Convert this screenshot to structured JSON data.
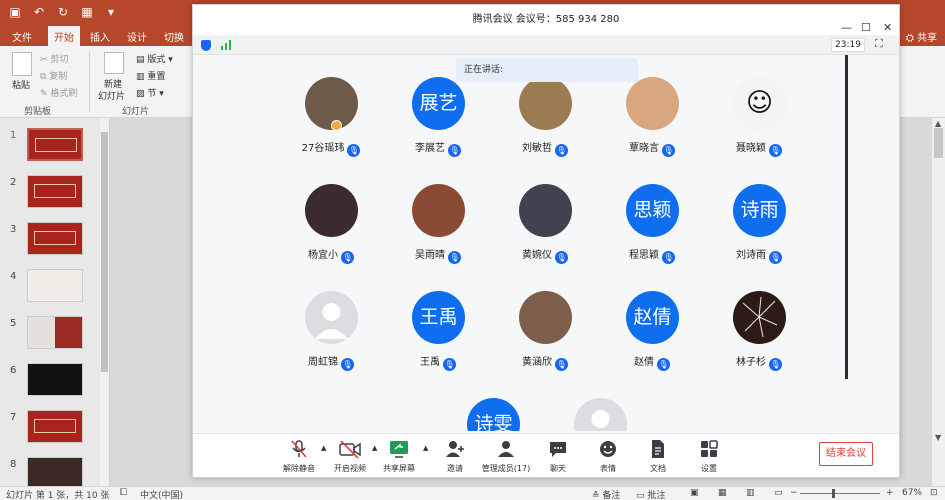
{
  "powerpoint": {
    "tabs": [
      "文件",
      "开始",
      "插入",
      "设计",
      "切换"
    ],
    "share": "共享",
    "ribbon": {
      "paste": "粘贴",
      "cut": "剪切",
      "copy": "复制",
      "format_painter": "格式刷",
      "clipboard": "剪贴板",
      "new_slide_1": "新建",
      "new_slide_2": "幻灯片",
      "layout": "版式",
      "reset": "重置",
      "section": "节",
      "slides_group": "幻灯片"
    },
    "slide_numbers": [
      "1",
      "2",
      "3",
      "4",
      "5",
      "6",
      "7",
      "8"
    ],
    "status": {
      "slide_info": "幻灯片 第 1 张，共 10 张",
      "language": "中文(中国)",
      "notes": "备注",
      "comments": "批注",
      "zoom": "67%"
    }
  },
  "meeting": {
    "title": "腾讯会议 会议号：585 934 280",
    "timer": "23:19",
    "speaking_label": "正在讲话:",
    "participants": [
      {
        "name": "27谷瑶玮",
        "avatar_type": "photo",
        "avatar_color": "#6e5a48",
        "host": true
      },
      {
        "name": "李展艺",
        "avatar_type": "text",
        "avatar_text": "展艺"
      },
      {
        "name": "刘敏哲",
        "avatar_type": "photo",
        "avatar_color": "#9a7b52"
      },
      {
        "name": "覃晓言",
        "avatar_type": "photo",
        "avatar_color": "#d8a77f"
      },
      {
        "name": "聂晓颖",
        "avatar_type": "photo",
        "avatar_color": "#f4f4f4"
      },
      {
        "name": "杨宜小",
        "avatar_type": "photo",
        "avatar_color": "#3b2a2f"
      },
      {
        "name": "吴雨晴",
        "avatar_type": "photo",
        "avatar_color": "#8a4b35"
      },
      {
        "name": "黄婉仪",
        "avatar_type": "photo",
        "avatar_color": "#40434f"
      },
      {
        "name": "程思颖",
        "avatar_type": "text",
        "avatar_text": "思颖"
      },
      {
        "name": "刘诗雨",
        "avatar_type": "text",
        "avatar_text": "诗雨"
      },
      {
        "name": "周虹锦",
        "avatar_type": "grey"
      },
      {
        "name": "王禹",
        "avatar_type": "text",
        "avatar_text": "王禹"
      },
      {
        "name": "黄涵欣",
        "avatar_type": "photo",
        "avatar_color": "#7d5e4a"
      },
      {
        "name": "赵倩",
        "avatar_type": "text",
        "avatar_text": "赵倩"
      },
      {
        "name": "林子杉",
        "avatar_type": "photo",
        "avatar_color": "#2b1a16"
      },
      {
        "name": "",
        "avatar_type": "text",
        "avatar_text": "诗雯"
      },
      {
        "name": "",
        "avatar_type": "grey"
      }
    ],
    "toolbar": {
      "mute": "解除静音",
      "video": "开启视频",
      "share": "共享屏幕",
      "invite": "邀请",
      "members": "管理成员(17)",
      "chat": "聊天",
      "reactions": "表情",
      "docs": "文档",
      "settings": "设置",
      "end": "结束会议"
    }
  }
}
